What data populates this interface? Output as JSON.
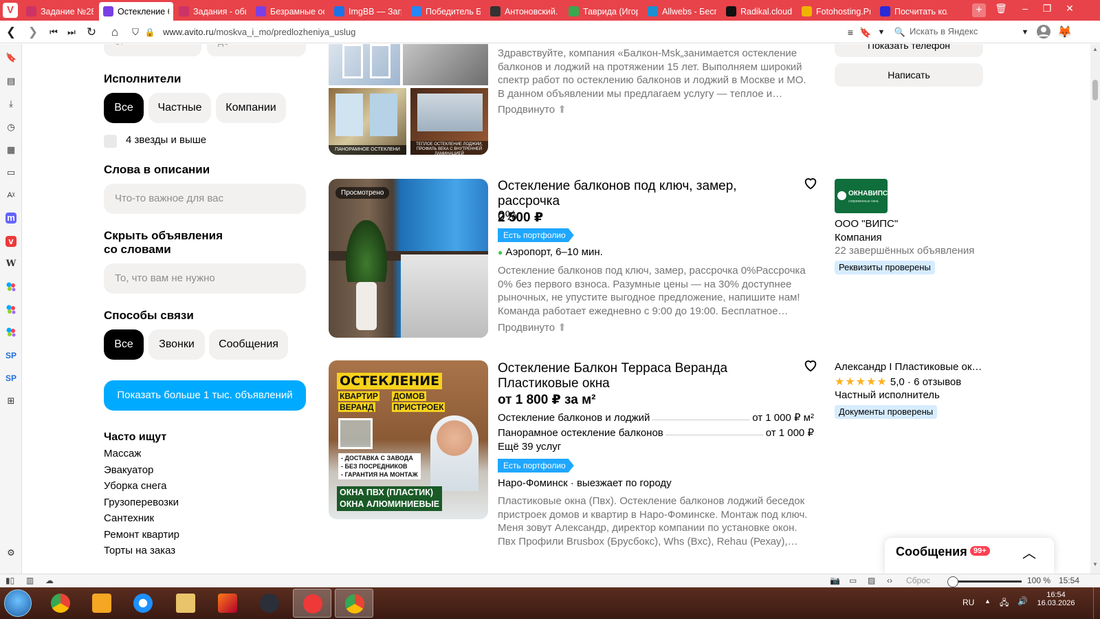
{
  "browser": {
    "tabs": [
      {
        "title": "Задание №28",
        "fav": "ps",
        "color": "#cc3366"
      },
      {
        "title": "Остекление ба",
        "fav": "av",
        "color": "#7a3fe4",
        "active": true
      },
      {
        "title": "Задания - общ",
        "fav": "ps",
        "color": "#cc3366"
      },
      {
        "title": "Безрамные ос",
        "fav": "av",
        "color": "#7a3fe4"
      },
      {
        "title": "ImgBB — Загр",
        "fav": "ibb",
        "color": "#1a73e8"
      },
      {
        "title": "Победитель Б",
        "fav": "vk",
        "color": "#2787f5"
      },
      {
        "title": "Антоновский.",
        "fav": "lib",
        "color": "#333333"
      },
      {
        "title": "Таврида (Игор",
        "fav": "tv",
        "color": "#3aa84f"
      },
      {
        "title": "Allwebs - Бесп",
        "fav": "aw",
        "color": "#1d8ecf"
      },
      {
        "title": "Radikal.cloud",
        "fav": "R",
        "color": "#111111"
      },
      {
        "title": "Fotohosting.Pr",
        "fav": "F",
        "color": "#f0b400"
      },
      {
        "title": "Посчитать кол",
        "fav": "pk",
        "color": "#2b2bd9"
      }
    ],
    "url_domain": "www.avito.ru",
    "url_path": "/moskva_i_mo/predlozheniya_uslug",
    "search_placeholder": "Искать в Яндекс"
  },
  "filters": {
    "range_from": "от",
    "range_to": "до",
    "performers_title": "Исполнители",
    "performers": [
      "Все",
      "Частные",
      "Компании"
    ],
    "stars_label": "4 звезды и выше",
    "words_title": "Слова в описании",
    "words_placeholder": "Что-то важное для вас",
    "hide_title_1": "Скрыть объявления",
    "hide_title_2": "со словами",
    "hide_placeholder": "То, что вам не нужно",
    "contact_title": "Способы связи",
    "contact": [
      "Все",
      "Звонки",
      "Сообщения"
    ],
    "show_more": "Показать больше 1 тыс. объявлений",
    "often_title": "Часто ищут",
    "often": [
      "Массаж",
      "Эвакуатор",
      "Уборка снега",
      "Грузоперевозки",
      "Сантехник",
      "Ремонт квартир",
      "Торты на заказ"
    ]
  },
  "listings": [
    {
      "desc_lines": [
        "Здравствуйте, компания «Балкон-Msk„занимается остекление",
        "балконов и лоджий на протяжении 15 лет. Выполняем широкий",
        "спектр работ по остеклению балконов и лоджий в Москве и МО.",
        "В данном объявлении мы предлагаем услугу — теплое и…"
      ],
      "more": "Продвинуто",
      "thumb_captions": [
        "ПАНОРАМНОЕ ОСТЕКЛЕНИ",
        "ТЕПЛОЕ ОСТЕКЛЕНИЕ ЛОДЖИИ, ПРОФИЛЬ ВЕКА С ВНУТРЕННЕЙ ЛАМИНАЦИЕЙ"
      ],
      "seller": {
        "phone_btn": "Показать телефон",
        "write_btn": "Написать"
      }
    },
    {
      "viewed": "Просмотрено",
      "title_1": "Остекление балконов под ключ, замер, рассрочка",
      "title_2": "0%",
      "price": "2 500 ₽",
      "badge": "Есть портфолио",
      "location": "Аэропорт, 6–10 мин.",
      "desc_lines": [
        "Остекление балконов под ключ, замер, рассрочка 0%Рассрочка",
        "0% без первого взноса. Разумные цены — на 30% доступнее",
        "рыночных, не упустите выгодное предложение, напишите нам!",
        "Команда работает ежедневно с 9:00 до 19:00. Бесплатное…"
      ],
      "more": "Продвинуто",
      "seller": {
        "logo_text": "ОКНАВИПС",
        "logo_sub": "современные окна",
        "name": "ООО \"ВИПС\"",
        "type": "Компания",
        "stats": "22 завершённых объявления",
        "badge": "Реквизиты проверены"
      }
    },
    {
      "title_1": "Остекление Балкон Терраса Веранда",
      "title_2": "Пластиковые окна",
      "price": "от 1 800 ₽ за м²",
      "services": [
        {
          "name": "Остекление балконов и лоджий",
          "price": "от 1 000 ₽ м²"
        },
        {
          "name": "Панорамное остекление балконов",
          "price": "от 1 000 ₽"
        }
      ],
      "more_services": "Ещё 39 услуг",
      "badge": "Есть портфолио",
      "location": "Наро-Фоминск · выезжает по городу",
      "desc_lines": [
        "Пластиковые окна (Пвх). Остекление балконов лоджий беседок",
        "пристроек домов и квартир в Наро-Фоминске. Монтаж под ключ.",
        "Меня зовут Александр, директор компании по установке окон.",
        "Пвх Профили Brusbox (Брусбокс), Whs (Вхс), Rehau (Рехау),…"
      ],
      "ad_image": {
        "head": "ОСТЕКЛЕНИЕ",
        "row1a": "КВАРТИР",
        "row1b": "ДОМОВ",
        "row2a": "ВЕРАНД",
        "row2b": "ПРИСТРОЕК",
        "bullets": [
          "- ДОСТАВКА С ЗАВОДА",
          "- БЕЗ ПОСРЕДНИКОВ",
          "- ГАРАНТИЯ НА МОНТАЖ"
        ],
        "foot1": "ОКНА ПВХ (ПЛАСТИК)",
        "foot2": "ОКНА АЛЮМИНИЕВЫЕ"
      },
      "seller": {
        "name": "Александр I Пластиковые ок…",
        "rating": "5,0",
        "reviews": "· 6 отзывов",
        "type": "Частный исполнитель",
        "badge": "Документы проверены"
      }
    }
  ],
  "messages": {
    "label": "Сообщения",
    "count": "99+"
  },
  "statusbar": {
    "reset": "Сброс",
    "zoom": "100 %",
    "time": "15:54"
  },
  "taskbar": {
    "lang": "RU",
    "time": "16:54",
    "date": "16.03.2026"
  },
  "colors": {
    "accent": "#00aaff",
    "browser_red": "#e8434a",
    "badge_blue": "#1fa7ff",
    "badge_light": "#d6ecff"
  }
}
